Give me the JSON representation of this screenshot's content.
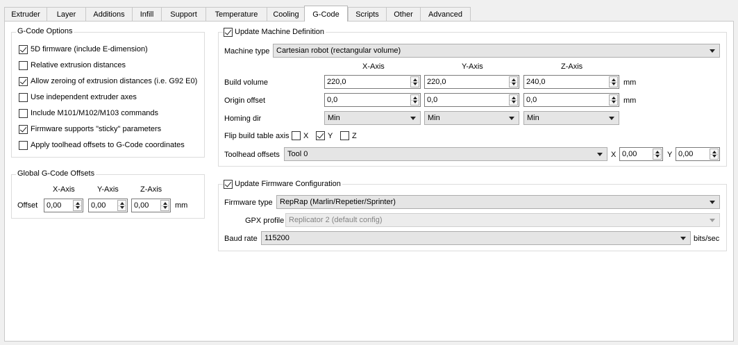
{
  "tabs": [
    "Extruder",
    "Layer",
    "Additions",
    "Infill",
    "Support",
    "Temperature",
    "Cooling",
    "G-Code",
    "Scripts",
    "Other",
    "Advanced"
  ],
  "gcode_options": {
    "title": "G-Code Options",
    "items": [
      {
        "label": "5D firmware (include E-dimension)",
        "checked": true
      },
      {
        "label": "Relative extrusion distances",
        "checked": false
      },
      {
        "label": "Allow zeroing of extrusion distances (i.e. G92 E0)",
        "checked": true
      },
      {
        "label": "Use independent extruder axes",
        "checked": false
      },
      {
        "label": "Include M101/M102/M103 commands",
        "checked": false
      },
      {
        "label": "Firmware supports \"sticky\" parameters",
        "checked": true
      },
      {
        "label": "Apply toolhead offsets to G-Code coordinates",
        "checked": false
      }
    ]
  },
  "global_offsets": {
    "title": "Global G-Code Offsets",
    "x_header": "X-Axis",
    "y_header": "Y-Axis",
    "z_header": "Z-Axis",
    "offset_label": "Offset",
    "x": "0,00",
    "y": "0,00",
    "z": "0,00",
    "unit": "mm"
  },
  "machine": {
    "title": "Update Machine Definition",
    "checked": true,
    "machine_type_label": "Machine type",
    "machine_type": "Cartesian robot (rectangular volume)",
    "x_header": "X-Axis",
    "y_header": "Y-Axis",
    "z_header": "Z-Axis",
    "build_volume_label": "Build volume",
    "build_x": "220,0",
    "build_y": "220,0",
    "build_z": "240,0",
    "build_unit": "mm",
    "origin_label": "Origin offset",
    "origin_x": "0,0",
    "origin_y": "0,0",
    "origin_z": "0,0",
    "origin_unit": "mm",
    "homing_label": "Homing dir",
    "homing_x": "Min",
    "homing_y": "Min",
    "homing_z": "Min",
    "flip_label": "Flip build table axis",
    "flip_x_label": "X",
    "flip_x": false,
    "flip_y_label": "Y",
    "flip_y": true,
    "flip_z_label": "Z",
    "flip_z": false,
    "toolhead_label": "Toolhead offsets",
    "toolhead": "Tool 0",
    "tool_x_label": "X",
    "tool_x": "0,00",
    "tool_y_label": "Y",
    "tool_y": "0,00"
  },
  "firmware": {
    "title": "Update Firmware Configuration",
    "checked": true,
    "type_label": "Firmware type",
    "type": "RepRap (Marlin/Repetier/Sprinter)",
    "gpx_label": "GPX profile",
    "gpx": "Replicator 2 (default config)",
    "baud_label": "Baud rate",
    "baud": "115200",
    "baud_unit": "bits/sec"
  }
}
